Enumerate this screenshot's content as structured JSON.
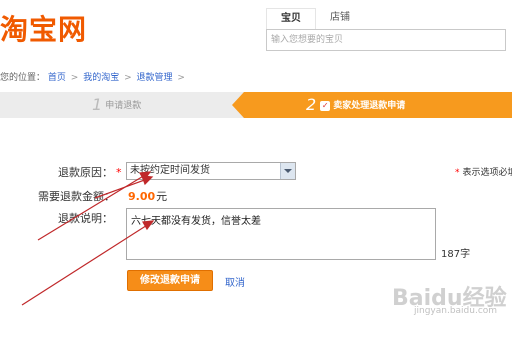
{
  "logo": {
    "text": "淘宝网",
    "color": "#f05a00"
  },
  "search": {
    "tabs": [
      {
        "label": "宝贝",
        "active": true
      },
      {
        "label": "店铺",
        "active": false
      }
    ],
    "placeholder": "输入您想要的宝贝"
  },
  "breadcrumb": {
    "prefix": "您的位置：",
    "items": [
      "首页",
      "我的淘宝",
      "退款管理"
    ],
    "separator": ">"
  },
  "steps": [
    {
      "number": "1",
      "label": "申请退款",
      "active": false
    },
    {
      "number": "2",
      "label": "卖家处理退款申请",
      "active": true,
      "accent": "#f79a1e"
    }
  ],
  "form": {
    "reason_label": "退款原因：",
    "reason_value": "未按约定时间发货",
    "amount_label": "需要退款金额：",
    "amount_value": "9.00",
    "amount_unit": "元",
    "desc_label": "退款说明：",
    "desc_value": "六七天都没有发货，信誉太差",
    "char_count": "187字",
    "required_mark": "*",
    "hint": "表示选项必填",
    "submit_label": "修改退款申请",
    "cancel_label": "取消"
  },
  "watermark": {
    "text": "Baidu经验",
    "sub": "jingyan.baidu.com"
  },
  "annotation_color": "#c0282a"
}
